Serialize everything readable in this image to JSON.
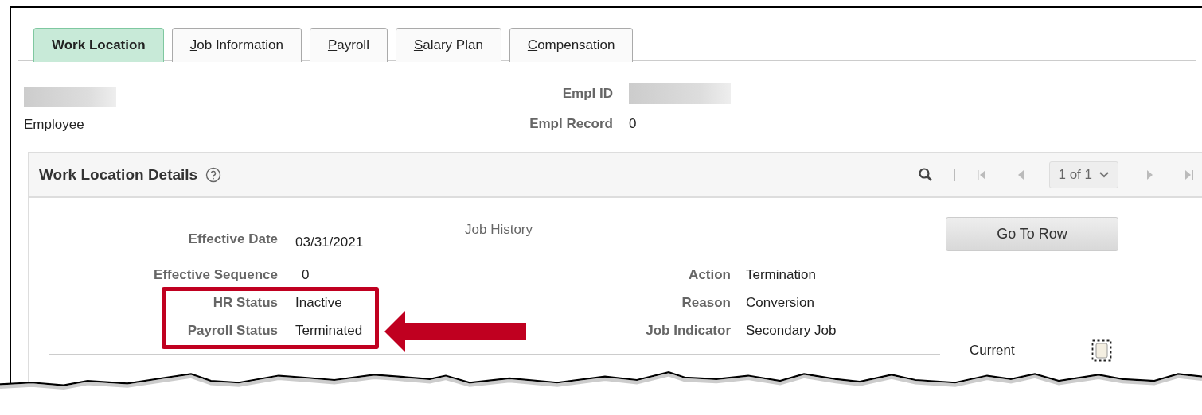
{
  "tabs": [
    {
      "label": "Work Location",
      "selected": true,
      "mnemonic": false
    },
    {
      "label": "Job Information",
      "selected": false,
      "mnemonic": true
    },
    {
      "label": "Payroll",
      "selected": false,
      "mnemonic": true
    },
    {
      "label": "Salary Plan",
      "selected": false,
      "mnemonic": true
    },
    {
      "label": "Compensation",
      "selected": false,
      "mnemonic": true
    }
  ],
  "header": {
    "employee_label": "Employee",
    "empl_id_label": "Empl ID",
    "empl_record_label": "Empl Record",
    "empl_record": "0"
  },
  "panel": {
    "title": "Work Location Details",
    "pager": "1 of 1",
    "job_history": "Job History",
    "go_to_row": "Go To Row",
    "left_fields": [
      {
        "label": "Effective Date",
        "value": "03/31/2021"
      },
      {
        "label": "Effective Sequence",
        "value": "0"
      },
      {
        "label": "HR Status",
        "value": "Inactive"
      },
      {
        "label": "Payroll Status",
        "value": "Terminated"
      }
    ],
    "right_fields": [
      {
        "label": "Action",
        "value": "Termination"
      },
      {
        "label": "Reason",
        "value": "Conversion"
      },
      {
        "label": "Job Indicator",
        "value": "Secondary Job"
      }
    ],
    "current": {
      "label": "Current",
      "checked": false
    }
  }
}
